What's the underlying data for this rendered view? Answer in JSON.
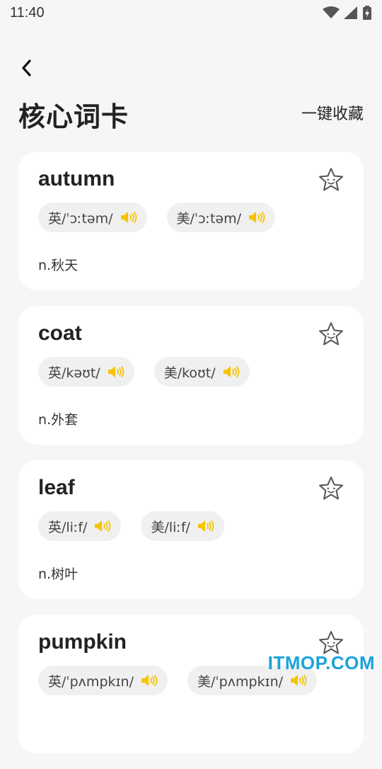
{
  "status": {
    "time": "11:40"
  },
  "header": {
    "title": "核心词卡",
    "collect_all": "一键收藏"
  },
  "cards": [
    {
      "word": "autumn",
      "uk": "英/ˈɔːtəm/",
      "us": "美/ˈɔːtəm/",
      "def": "n.秋天"
    },
    {
      "word": "coat",
      "uk": "英/kəʊt/",
      "us": "美/koʊt/",
      "def": "n.外套"
    },
    {
      "word": "leaf",
      "uk": "英/liːf/",
      "us": "美/liːf/",
      "def": "n.树叶"
    },
    {
      "word": "pumpkin",
      "uk": "英/ˈpʌmpkɪn/",
      "us": "美/ˈpʌmpkɪn/",
      "def": ""
    }
  ],
  "icons": {
    "speaker": "speaker-icon",
    "star": "star-icon",
    "back": "back-arrow-icon"
  },
  "colors": {
    "speaker": "#f5c400",
    "watermark": "#1aa3d9"
  },
  "watermark": "ITMOP.COM"
}
